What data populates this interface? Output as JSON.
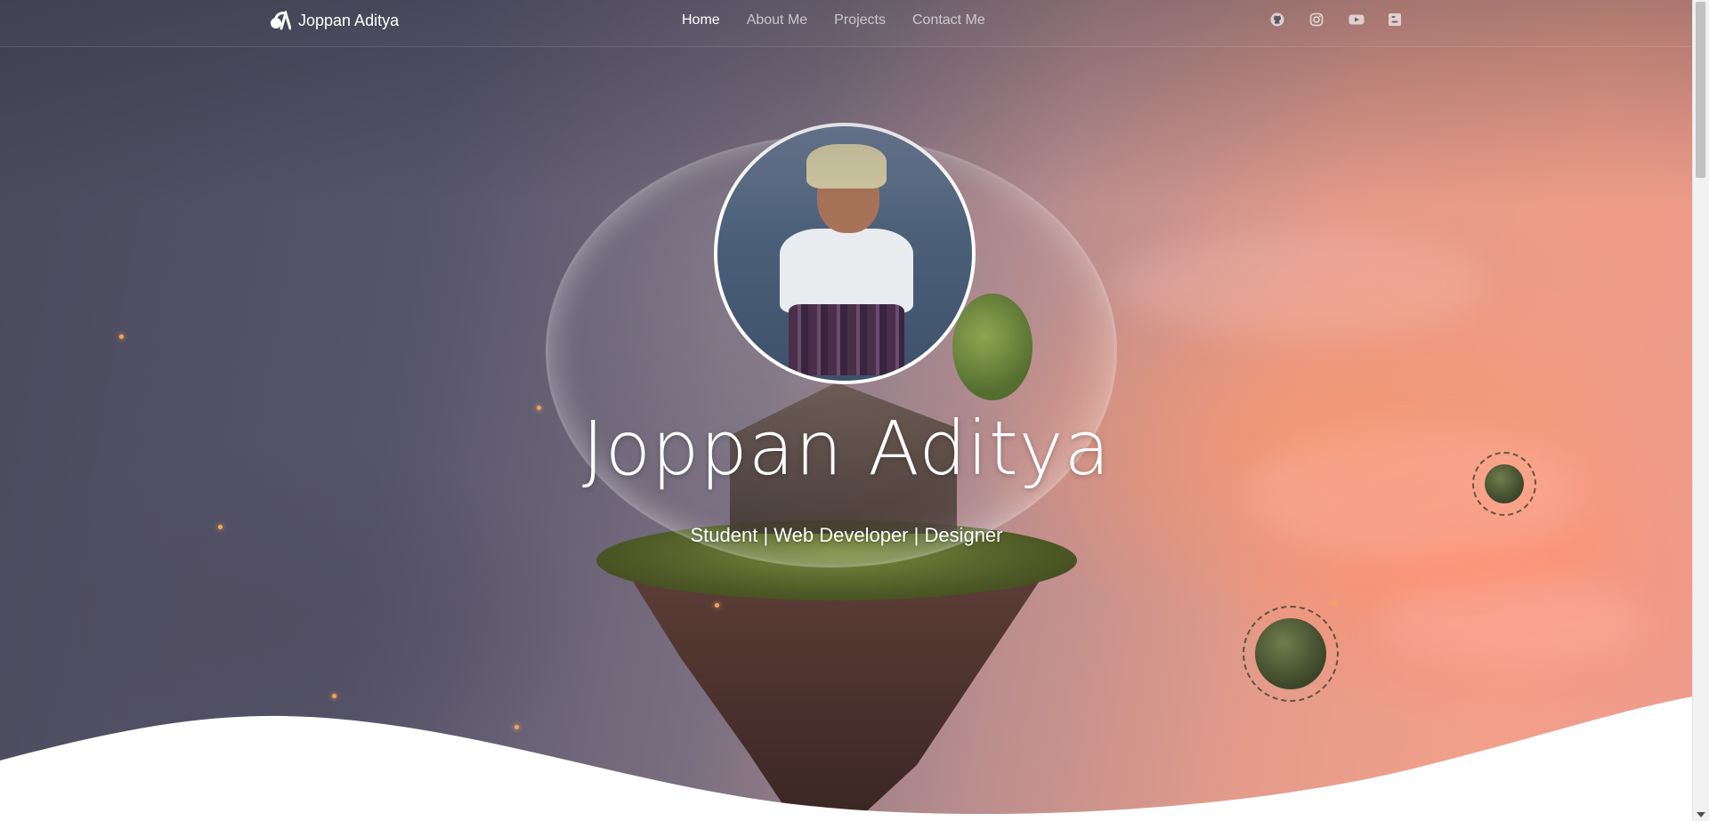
{
  "brand": {
    "name": "Joppan Aditya",
    "logo_icon": "logo-icon"
  },
  "nav": {
    "items": [
      {
        "label": "Home",
        "active": true
      },
      {
        "label": "About Me",
        "active": false
      },
      {
        "label": "Projects",
        "active": false
      },
      {
        "label": "Contact Me",
        "active": false
      }
    ]
  },
  "socials": [
    {
      "icon": "github-icon"
    },
    {
      "icon": "instagram-icon"
    },
    {
      "icon": "youtube-icon"
    },
    {
      "icon": "blogger-icon"
    }
  ],
  "hero": {
    "title": "Joppan Aditya",
    "subtitle": "Student | Web Developer | Designer"
  },
  "colors": {
    "text": "#ffffff",
    "nav_inactive": "rgba(255,255,255,0.65)",
    "wave": "#ffffff"
  }
}
